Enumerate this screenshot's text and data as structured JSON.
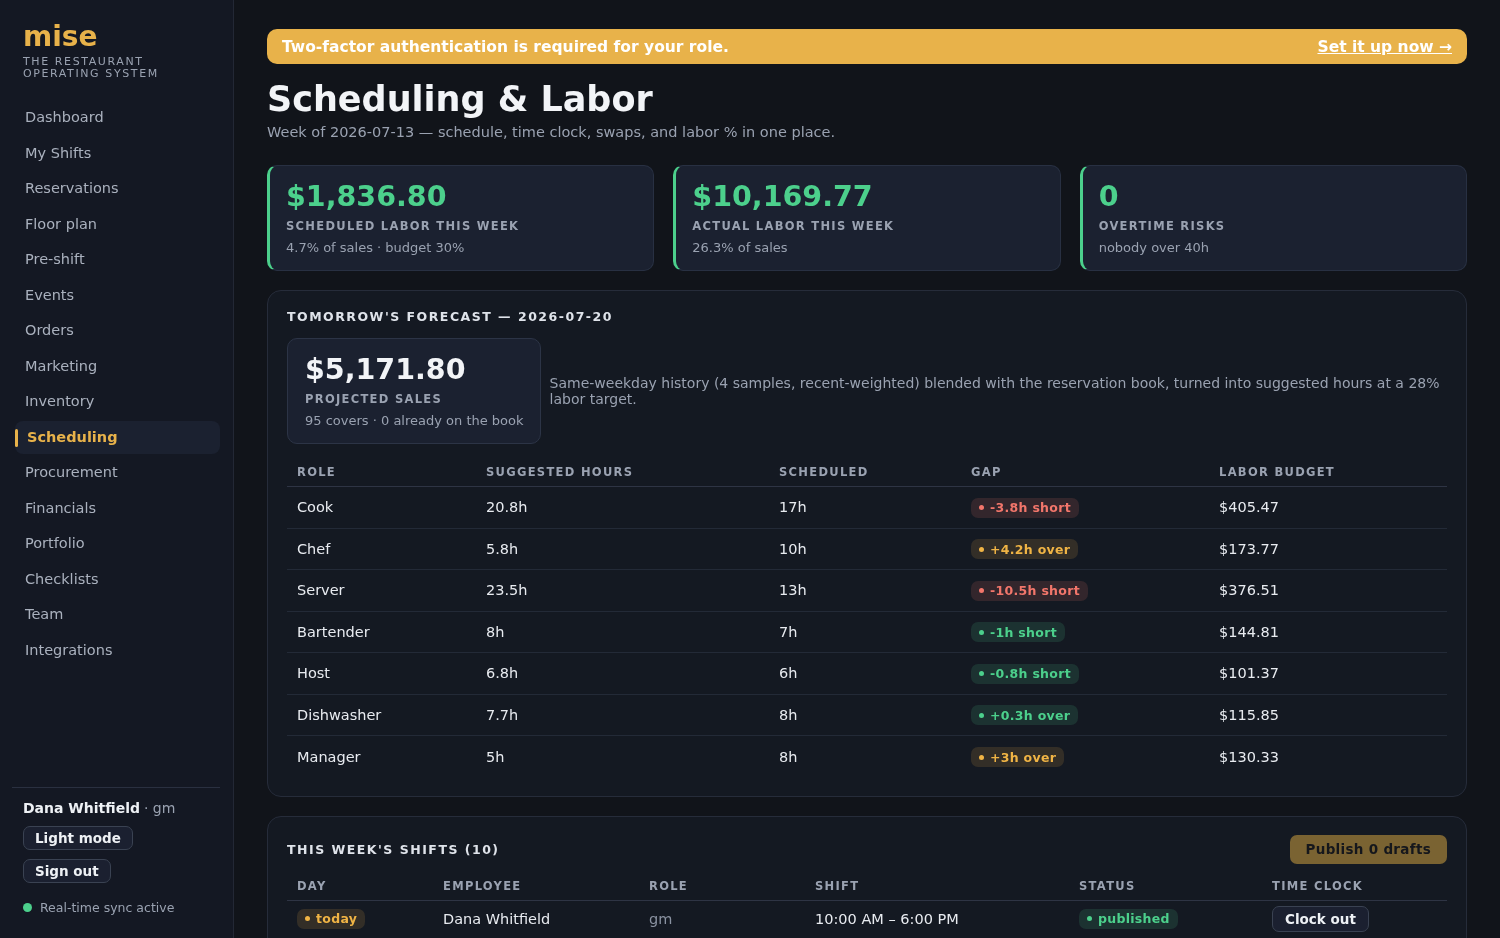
{
  "sidebar": {
    "logo": "mise",
    "tagline": "THE RESTAURANT OPERATING SYSTEM",
    "items": [
      {
        "label": "Dashboard",
        "selected": false
      },
      {
        "label": "My Shifts",
        "selected": false
      },
      {
        "label": "Reservations",
        "selected": false
      },
      {
        "label": "Floor plan",
        "selected": false
      },
      {
        "label": "Pre-shift",
        "selected": false
      },
      {
        "label": "Events",
        "selected": false
      },
      {
        "label": "Orders",
        "selected": false
      },
      {
        "label": "Marketing",
        "selected": false
      },
      {
        "label": "Inventory",
        "selected": false
      },
      {
        "label": "Scheduling",
        "selected": true
      },
      {
        "label": "Procurement",
        "selected": false
      },
      {
        "label": "Financials",
        "selected": false
      },
      {
        "label": "Portfolio",
        "selected": false
      },
      {
        "label": "Checklists",
        "selected": false
      },
      {
        "label": "Team",
        "selected": false
      },
      {
        "label": "Integrations",
        "selected": false
      }
    ],
    "user": {
      "name": "Dana Whitfield",
      "role": "· gm"
    },
    "buttons": [
      "Light mode",
      "Sign out"
    ],
    "sync": {
      "label": "Real-time sync active"
    }
  },
  "banner": {
    "message": "Two-factor authentication is required for your role.",
    "link": "Set it up now →"
  },
  "page": {
    "title": "Scheduling & Labor",
    "subtitle": "Week of 2026-07-13 — schedule, time clock, swaps, and labor % in one place."
  },
  "kpis": [
    {
      "value": "$1,836.80",
      "label": "SCHEDULED LABOR THIS WEEK",
      "note": "4.7% of sales · budget 30%"
    },
    {
      "value": "$10,169.77",
      "label": "ACTUAL LABOR THIS WEEK",
      "note": "26.3% of sales"
    },
    {
      "value": "0",
      "label": "OVERTIME RISKS",
      "note": "nobody over 40h"
    }
  ],
  "forecast": {
    "title": "TOMORROW'S FORECAST — 2026-07-20",
    "projection": {
      "value": "$5,171.80",
      "label": "PROJECTED SALES",
      "note": "95 covers · 0 already on the book"
    },
    "description": "Same-weekday history (4 samples, recent-weighted) blended with the reservation book, turned into suggested hours at a 28% labor target.",
    "table": {
      "columns": [
        "ROLE",
        "SUGGESTED HOURS",
        "SCHEDULED",
        "GAP",
        "LABOR BUDGET"
      ],
      "rows": [
        {
          "role": "Cook",
          "suggested": "20.8h",
          "scheduled": "17h",
          "gap": {
            "text": "-3.8h short",
            "color": "#f2766b"
          },
          "budget": "$405.47"
        },
        {
          "role": "Chef",
          "suggested": "5.8h",
          "scheduled": "10h",
          "gap": {
            "text": "+4.2h over",
            "color": "#f0b445"
          },
          "budget": "$173.77"
        },
        {
          "role": "Server",
          "suggested": "23.5h",
          "scheduled": "13h",
          "gap": {
            "text": "-10.5h short",
            "color": "#f2766b"
          },
          "budget": "$376.51"
        },
        {
          "role": "Bartender",
          "suggested": "8h",
          "scheduled": "7h",
          "gap": {
            "text": "-1h short",
            "color": "#4cd08c"
          },
          "budget": "$144.81"
        },
        {
          "role": "Host",
          "suggested": "6.8h",
          "scheduled": "6h",
          "gap": {
            "text": "-0.8h short",
            "color": "#4cd08c"
          },
          "budget": "$101.37"
        },
        {
          "role": "Dishwasher",
          "suggested": "7.7h",
          "scheduled": "8h",
          "gap": {
            "text": "+0.3h over",
            "color": "#4cd08c"
          },
          "budget": "$115.85"
        },
        {
          "role": "Manager",
          "suggested": "5h",
          "scheduled": "8h",
          "gap": {
            "text": "+3h over",
            "color": "#f0b445"
          },
          "budget": "$130.33"
        }
      ]
    }
  },
  "shifts": {
    "title": "THIS WEEK'S SHIFTS (10)",
    "publish_button": {
      "label": "Publish 0 drafts",
      "disabled": true
    },
    "columns": [
      "DAY",
      "EMPLOYEE",
      "ROLE",
      "SHIFT",
      "STATUS",
      "TIME CLOCK"
    ],
    "rows": [
      {
        "day": {
          "text": "today",
          "color": "#f0b445"
        },
        "employee": "Dana Whitfield",
        "role": "gm",
        "shift": "10:00 AM – 6:00 PM",
        "status": {
          "text": "published",
          "color": "#4cd08c"
        },
        "action": "Clock out"
      }
    ]
  }
}
